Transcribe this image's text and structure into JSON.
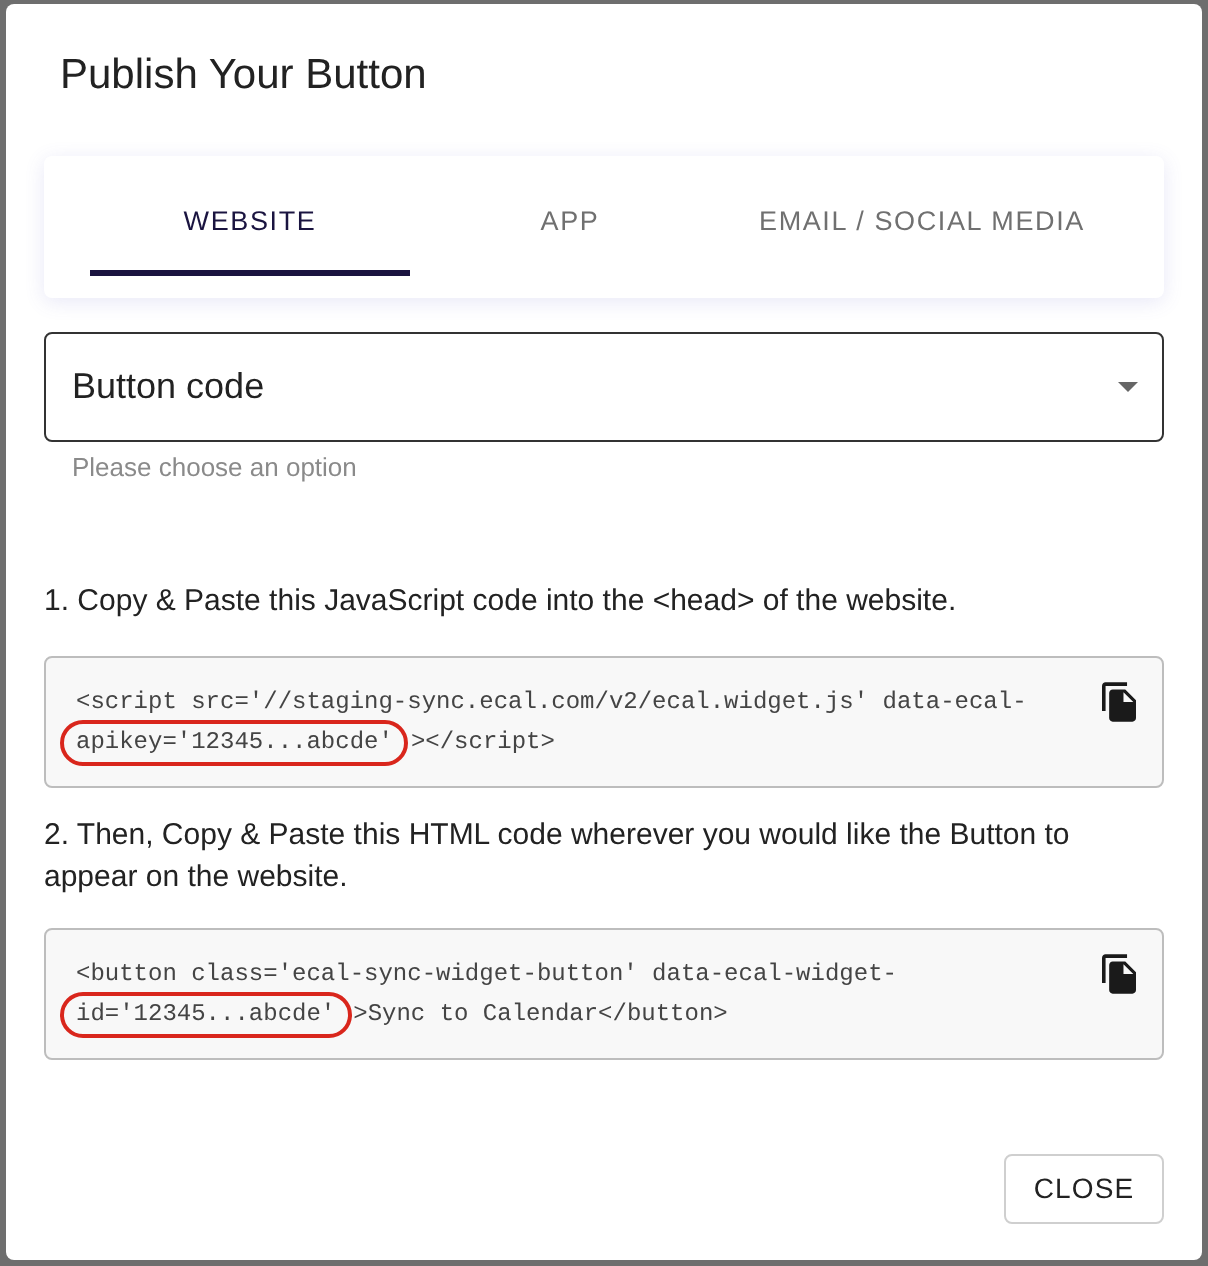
{
  "dialog": {
    "title": "Publish Your Button"
  },
  "tabs": [
    {
      "label": "WEBSITE",
      "selected": true
    },
    {
      "label": "APP",
      "selected": false
    },
    {
      "label": "EMAIL / SOCIAL MEDIA",
      "selected": false
    }
  ],
  "select": {
    "value": "Button code",
    "helper_text": "Please choose an option"
  },
  "steps": [
    {
      "instruction": "1. Copy & Paste this JavaScript code into the <head> of the website.",
      "code": {
        "line_1": "<script src='//staging-sync.ecal.com/v2/ecal.widget.js' data-ecal-",
        "circled": "apikey='12345...abcde'",
        "rest": "></script>"
      }
    },
    {
      "instruction": "2. Then, Copy & Paste this HTML code wherever you would like the Button to appear on the website.",
      "code": {
        "line_1": "<button class='ecal-sync-widget-button' data-ecal-widget-",
        "circled": "id='12345...abcde'",
        "rest": ">Sync to Calendar</button>"
      }
    }
  ],
  "buttons": [
    {
      "label": "CLOSE"
    }
  ]
}
